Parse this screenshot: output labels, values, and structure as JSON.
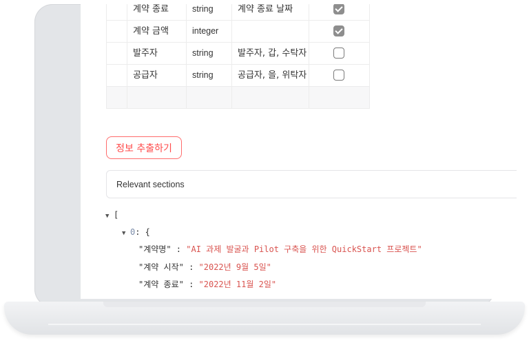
{
  "table": {
    "rows": [
      {
        "name": "계약 종료",
        "type": "string",
        "desc": "계약 종료 날짜",
        "checked": true
      },
      {
        "name": "계약 금액",
        "type": "integer",
        "desc": "",
        "checked": true
      },
      {
        "name": "발주자",
        "type": "string",
        "desc": "발주자, 갑, 수탁자",
        "checked": false
      },
      {
        "name": "공급자",
        "type": "string",
        "desc": "공급자, 을, 위탁자",
        "checked": false
      }
    ]
  },
  "extract_button": {
    "label": "정보 추출하기"
  },
  "expander": {
    "label": "Relevant sections"
  },
  "json_view": {
    "open_bracket": "[",
    "item_index": "0",
    "item_open": ": {",
    "entries": [
      {
        "key": "\"계약명\"",
        "sep": " : ",
        "value": "\"AI 과제 발굴과 Pilot 구축을 위한 QuickStart 프로젝트\""
      },
      {
        "key": "\"계약 시작\"",
        "sep": " : ",
        "value": "\"2022년 9월 5일\""
      },
      {
        "key": "\"계약 종료\"",
        "sep": " : ",
        "value": "\"2022년 11월 2일\""
      }
    ]
  },
  "colors": {
    "accent": "#ff4b4b",
    "json_string": "#d9534f",
    "checkbox_checked": "#8e8e8e"
  }
}
